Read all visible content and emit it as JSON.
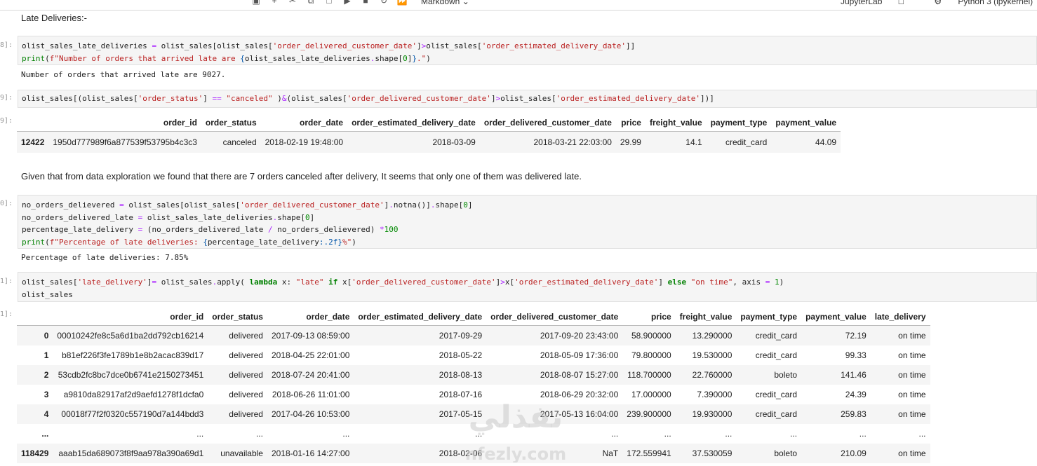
{
  "toolbar": {
    "icons": [
      "save-icon",
      "add-cell-icon",
      "cut-icon",
      "copy-icon",
      "paste-icon",
      "run-icon",
      "stop-icon",
      "restart-icon",
      "fast-forward-icon"
    ],
    "cell_type": "Markdown",
    "jupyterlab_label": "JupyterLab",
    "kernel_label": "Python 3 (ipykernel)"
  },
  "cells": {
    "heading": "Late Deliveries:-",
    "prompt1": "8]:",
    "prompt2": "9]:",
    "prompt2_out": "9]:",
    "prompt3": "0]:",
    "prompt4": "1]:",
    "prompt4_out": "1]:",
    "output1": "Number of orders that arrived late are 9027.",
    "markdown2": "Given that from data exploration we found that there are 7 orders canceled after delivery, It seems that only one of them was delivered late.",
    "output3": "Percentage of late deliveries: 7.85%"
  },
  "table1": {
    "columns": [
      "",
      "order_id",
      "order_status",
      "order_date",
      "order_estimated_delivery_date",
      "order_delivered_customer_date",
      "price",
      "freight_value",
      "payment_type",
      "payment_value"
    ],
    "rows": [
      [
        "12422",
        "1950d777989f6a877539f53795b4c3c3",
        "canceled",
        "2018-02-19 19:48:00",
        "2018-03-09",
        "2018-03-21 22:03:00",
        "29.99",
        "14.1",
        "credit_card",
        "44.09"
      ]
    ]
  },
  "table2": {
    "columns": [
      "",
      "order_id",
      "order_status",
      "order_date",
      "order_estimated_delivery_date",
      "order_delivered_customer_date",
      "price",
      "freight_value",
      "payment_type",
      "payment_value",
      "late_delivery"
    ],
    "rows": [
      [
        "0",
        "00010242fe8c5a6d1ba2dd792cb16214",
        "delivered",
        "2017-09-13 08:59:00",
        "2017-09-29",
        "2017-09-20 23:43:00",
        "58.900000",
        "13.290000",
        "credit_card",
        "72.19",
        "on time"
      ],
      [
        "1",
        "b81ef226f3fe1789b1e8b2acac839d17",
        "delivered",
        "2018-04-25 22:01:00",
        "2018-05-22",
        "2018-05-09 17:36:00",
        "79.800000",
        "19.530000",
        "credit_card",
        "99.33",
        "on time"
      ],
      [
        "2",
        "53cdb2fc8bc7dce0b6741e2150273451",
        "delivered",
        "2018-07-24 20:41:00",
        "2018-08-13",
        "2018-08-07 15:27:00",
        "118.700000",
        "22.760000",
        "boleto",
        "141.46",
        "on time"
      ],
      [
        "3",
        "a9810da82917af2d9aefd1278f1dcfa0",
        "delivered",
        "2018-06-26 11:01:00",
        "2018-07-16",
        "2018-06-29 20:32:00",
        "17.000000",
        "7.390000",
        "credit_card",
        "24.39",
        "on time"
      ],
      [
        "4",
        "00018f77f2f0320c557190d7a144bdd3",
        "delivered",
        "2017-04-26 10:53:00",
        "2017-05-15",
        "2017-05-13 16:04:00",
        "239.900000",
        "19.930000",
        "credit_card",
        "259.83",
        "on time"
      ],
      [
        "...",
        "...",
        "...",
        "...",
        "...",
        "...",
        "...",
        "...",
        "...",
        "...",
        "..."
      ],
      [
        "118429",
        "aaab15da689073f8f9aa978a390a69d1",
        "unavailable",
        "2018-01-16 14:27:00",
        "2018-02-06",
        "NaT",
        "172.559941",
        "37.530059",
        "boleto",
        "210.09",
        "on time"
      ]
    ]
  },
  "watermark": {
    "arabic": "نفذلي",
    "latin": "nfezly.com"
  }
}
